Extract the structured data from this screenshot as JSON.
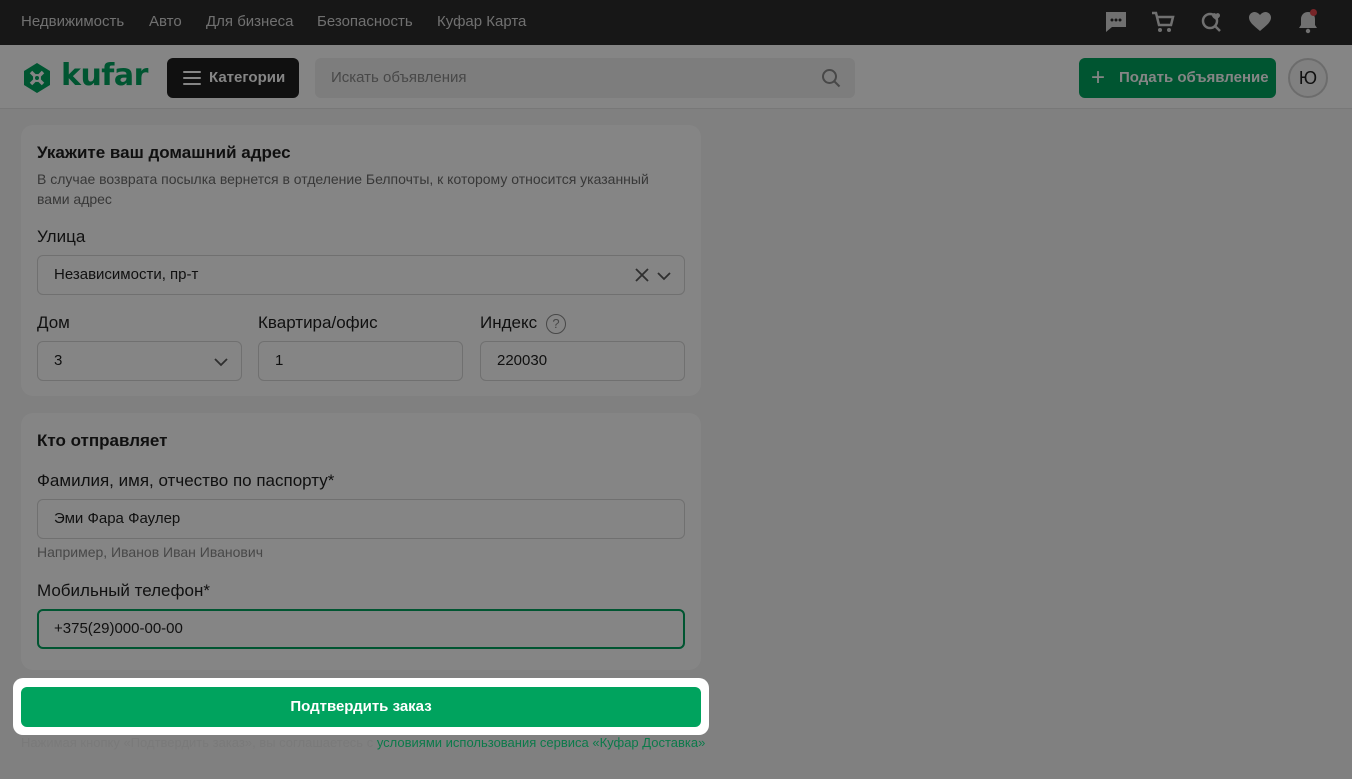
{
  "topnav": {
    "links": [
      "Недвижимость",
      "Авто",
      "Для бизнеса",
      "Безопасность",
      "Куфар Карта"
    ],
    "icons": [
      "chat-icon",
      "cart-icon",
      "saved-search-icon",
      "heart-icon",
      "bell-icon"
    ]
  },
  "header": {
    "logo_text": "kufar",
    "categories_label": "Категории",
    "search_placeholder": "Искать объявления",
    "post_ad_label": "Подать объявление",
    "avatar_initial": "Ю"
  },
  "address": {
    "title": "Укажите ваш домашний адрес",
    "subtitle": "В случае возврата посылка вернется в отделение Белпочты, к которому относится указанный вами адрес",
    "street_label": "Улица",
    "street_value": "Независимости, пр-т",
    "house_label": "Дом",
    "house_value": "3",
    "apartment_label": "Квартира/офис",
    "apartment_value": "1",
    "index_label": "Индекс",
    "index_value": "220030",
    "help_mark": "?"
  },
  "sender": {
    "title": "Кто отправляет",
    "name_label": "Фамилия, имя, отчество по паспорту*",
    "name_value": "Эми Фара Фаулер",
    "name_hint": "Например, Иванов Иван Иванович",
    "phone_label": "Мобильный телефон*",
    "phone_value": "+375(29)000-00-00"
  },
  "footer": {
    "confirm_label": "Подтвердить заказ",
    "terms_text": "Нажимая кнопку «Подтвердить заказ», вы соглашаетесь с ",
    "terms_link": "условиями использования сервиса «Куфар Доставка»"
  },
  "colors": {
    "accent": "#00a35e",
    "topbar": "#2d2d2d",
    "notification_dot": "#e5484d"
  }
}
